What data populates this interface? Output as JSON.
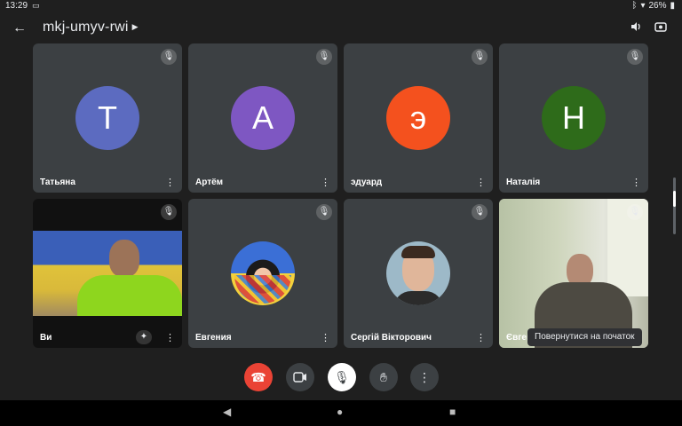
{
  "status": {
    "time": "13:29",
    "battery": "26%"
  },
  "header": {
    "title": "mkj-umyv-rwi"
  },
  "participants": [
    {
      "name": "Татьяна",
      "initial": "Т",
      "color": "#5c6bc0"
    },
    {
      "name": "Артём",
      "initial": "А",
      "color": "#7e57c2"
    },
    {
      "name": "эдуард",
      "initial": "э",
      "color": "#f4511e"
    },
    {
      "name": "Наталія",
      "initial": "Н",
      "color": "#2e6b1a"
    },
    {
      "name": "Ви"
    },
    {
      "name": "Евгения"
    },
    {
      "name": "Сергій  Вікторович"
    },
    {
      "name": "Євген"
    }
  ],
  "tooltip": "Повернутися на початок",
  "icons": {
    "back": "arrow-back-icon",
    "volume": "volume-icon",
    "switch_camera": "switch-camera-icon",
    "mic_off": "mic-off-icon",
    "more": "more-vert-icon",
    "end_call": "end-call-icon",
    "camera": "camera-icon",
    "raise_hand": "raise-hand-icon"
  }
}
